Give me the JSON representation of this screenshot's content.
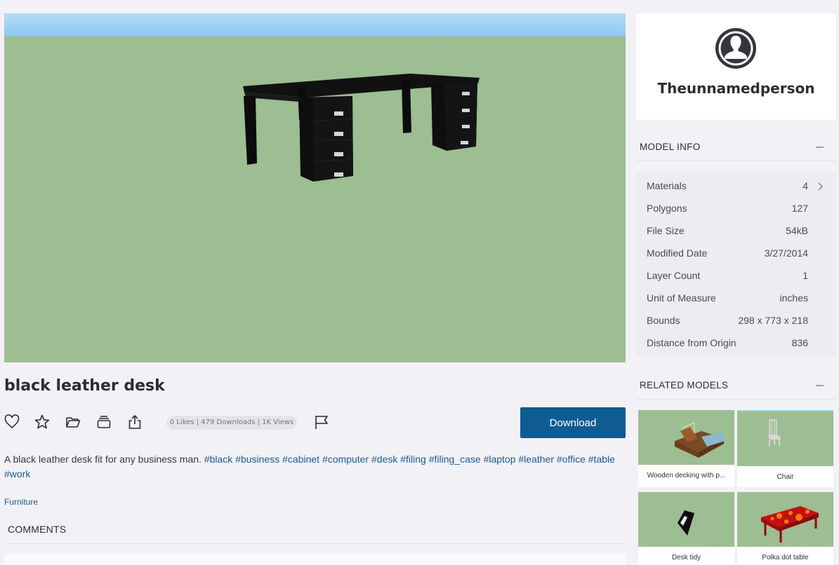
{
  "model": {
    "title": "black leather desk",
    "stats": "0 Likes | 479 Downloads | 1K Views",
    "download_label": "Download",
    "description": "A black leather desk fit for any business man.",
    "tags": [
      "#black",
      "#business",
      "#cabinet",
      "#computer",
      "#desk",
      "#filing",
      "#filing_case",
      "#laptop",
      "#leather",
      "#office",
      "#table",
      "#work"
    ],
    "category": "Furniture"
  },
  "actions": [
    {
      "name": "like-heart-icon"
    },
    {
      "name": "favorite-star-icon"
    },
    {
      "name": "add-to-folder-icon"
    },
    {
      "name": "add-to-collection-icon"
    },
    {
      "name": "share-icon"
    }
  ],
  "report": {
    "name": "report-flag-icon"
  },
  "comments": {
    "heading": "COMMENTS"
  },
  "author": {
    "name": "Theunnamedperson"
  },
  "model_info": {
    "heading": "MODEL INFO",
    "rows": [
      {
        "key": "Materials",
        "value": "4"
      },
      {
        "key": "Polygons",
        "value": "127"
      },
      {
        "key": "File Size",
        "value": "54kB"
      },
      {
        "key": "Modified Date",
        "value": "3/27/2014"
      },
      {
        "key": "Layer Count",
        "value": "1"
      },
      {
        "key": "Unit of Measure",
        "value": "inches"
      },
      {
        "key": "Bounds",
        "value": "298 x 773 x 218"
      },
      {
        "key": "Distance from Origin",
        "value": "836"
      }
    ]
  },
  "related": {
    "heading": "RELATED MODELS",
    "items": [
      {
        "caption": "Wooden decking with p..."
      },
      {
        "caption": "Chair"
      },
      {
        "caption": "Desk tidy"
      },
      {
        "caption": "Polka dot table"
      }
    ]
  },
  "colors": {
    "accent": "#0f5c94",
    "link": "#1c5b95",
    "viewer_ground": "#9dbd93",
    "page_bg": "#f2f1f6"
  }
}
